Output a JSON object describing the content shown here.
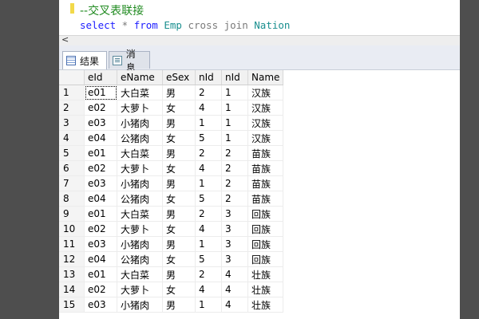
{
  "editor": {
    "comment": "--交叉表联接",
    "sql_select": "select",
    "sql_star": " * ",
    "sql_from": "from",
    "sql_table1": "Emp",
    "sql_cross_join": " cross join ",
    "sql_table2": "Nation"
  },
  "scrollbar": {
    "left_arrow": "<"
  },
  "tabs": [
    {
      "label": "结果",
      "icon": "grid-icon"
    },
    {
      "label": "消息",
      "icon": "messages-icon"
    }
  ],
  "grid": {
    "columns": [
      "eId",
      "eName",
      "eSex",
      "nId",
      "nId",
      "Name"
    ],
    "rows": [
      [
        "1",
        "e01",
        "大白菜",
        "男",
        "2",
        "1",
        "汉族"
      ],
      [
        "2",
        "e02",
        "大萝卜",
        "女",
        "4",
        "1",
        "汉族"
      ],
      [
        "3",
        "e03",
        "小猪肉",
        "男",
        "1",
        "1",
        "汉族"
      ],
      [
        "4",
        "e04",
        "公猪肉",
        "女",
        "5",
        "1",
        "汉族"
      ],
      [
        "5",
        "e01",
        "大白菜",
        "男",
        "2",
        "2",
        "苗族"
      ],
      [
        "6",
        "e02",
        "大萝卜",
        "女",
        "4",
        "2",
        "苗族"
      ],
      [
        "7",
        "e03",
        "小猪肉",
        "男",
        "1",
        "2",
        "苗族"
      ],
      [
        "8",
        "e04",
        "公猪肉",
        "女",
        "5",
        "2",
        "苗族"
      ],
      [
        "9",
        "e01",
        "大白菜",
        "男",
        "2",
        "3",
        "回族"
      ],
      [
        "10",
        "e02",
        "大萝卜",
        "女",
        "4",
        "3",
        "回族"
      ],
      [
        "11",
        "e03",
        "小猪肉",
        "男",
        "1",
        "3",
        "回族"
      ],
      [
        "12",
        "e04",
        "公猪肉",
        "女",
        "5",
        "3",
        "回族"
      ],
      [
        "13",
        "e01",
        "大白菜",
        "男",
        "2",
        "4",
        "壮族"
      ],
      [
        "14",
        "e02",
        "大萝卜",
        "女",
        "4",
        "4",
        "壮族"
      ],
      [
        "15",
        "e03",
        "小猪肉",
        "男",
        "1",
        "4",
        "壮族"
      ]
    ]
  },
  "colors": {
    "comment": "#1f8a1f",
    "keyword": "#2020ff",
    "identifier": "#1a8f8f",
    "gutter": "#4e4e4e"
  }
}
